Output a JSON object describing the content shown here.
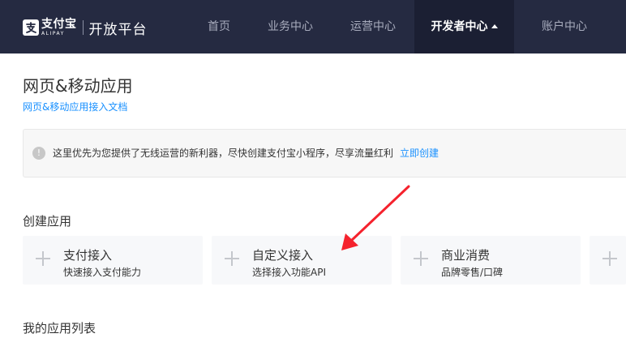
{
  "header": {
    "logo_cn": "支付宝",
    "logo_en": "ALIPAY",
    "platform": "开放平台",
    "nav": [
      {
        "label": "首页"
      },
      {
        "label": "业务中心"
      },
      {
        "label": "运营中心"
      },
      {
        "label": "开发者中心",
        "active": true
      },
      {
        "label": "账户中心"
      }
    ]
  },
  "main": {
    "title": "网页&移动应用",
    "doc_link": "网页&移动应用接入文档",
    "notice": {
      "text": "这里优先为您提供了无线运营的新利器，尽快创建支付宝小程序，尽享流量红利",
      "link": "立即创建"
    },
    "create_section": {
      "title": "创建应用",
      "cards": [
        {
          "title": "支付接入",
          "desc": "快速接入支付能力"
        },
        {
          "title": "自定义接入",
          "desc": "选择接入功能API"
        },
        {
          "title": "商业消费",
          "desc": "品牌零售/口碑"
        }
      ]
    },
    "list_section": {
      "title": "我的应用列表"
    }
  },
  "colors": {
    "header_bg": "#252a41",
    "header_active_bg": "#1b1f33",
    "link": "#1890ff",
    "annotation_arrow": "#f5222d"
  }
}
